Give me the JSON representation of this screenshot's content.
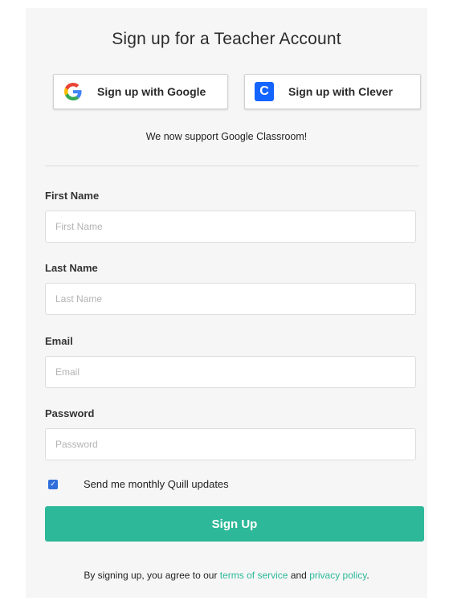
{
  "title": "Sign up for a Teacher Account",
  "sso": {
    "google_label": "Sign up with Google",
    "clever_label": "Sign up with Clever",
    "clever_glyph": "C",
    "google_icon": "google-g-icon",
    "clever_icon": "clever-c-icon"
  },
  "notice": "We now support Google Classroom!",
  "fields": {
    "first_name": {
      "label": "First Name",
      "placeholder": "First Name",
      "value": ""
    },
    "last_name": {
      "label": "Last Name",
      "placeholder": "Last Name",
      "value": ""
    },
    "email": {
      "label": "Email",
      "placeholder": "Email",
      "value": ""
    },
    "password": {
      "label": "Password",
      "placeholder": "Password",
      "value": ""
    }
  },
  "newsletter": {
    "label": "Send me monthly Quill updates",
    "checked": true
  },
  "submit_label": "Sign Up",
  "legal": {
    "prefix": "By signing up, you agree to our",
    "terms_link": "terms of service",
    "joiner": "and",
    "privacy_link": "privacy policy",
    "suffix": "."
  },
  "colors": {
    "accent": "#2db899",
    "checkbox": "#2f6fdb",
    "clever_blue": "#1464ff",
    "panel_bg": "#f6f6f6"
  }
}
